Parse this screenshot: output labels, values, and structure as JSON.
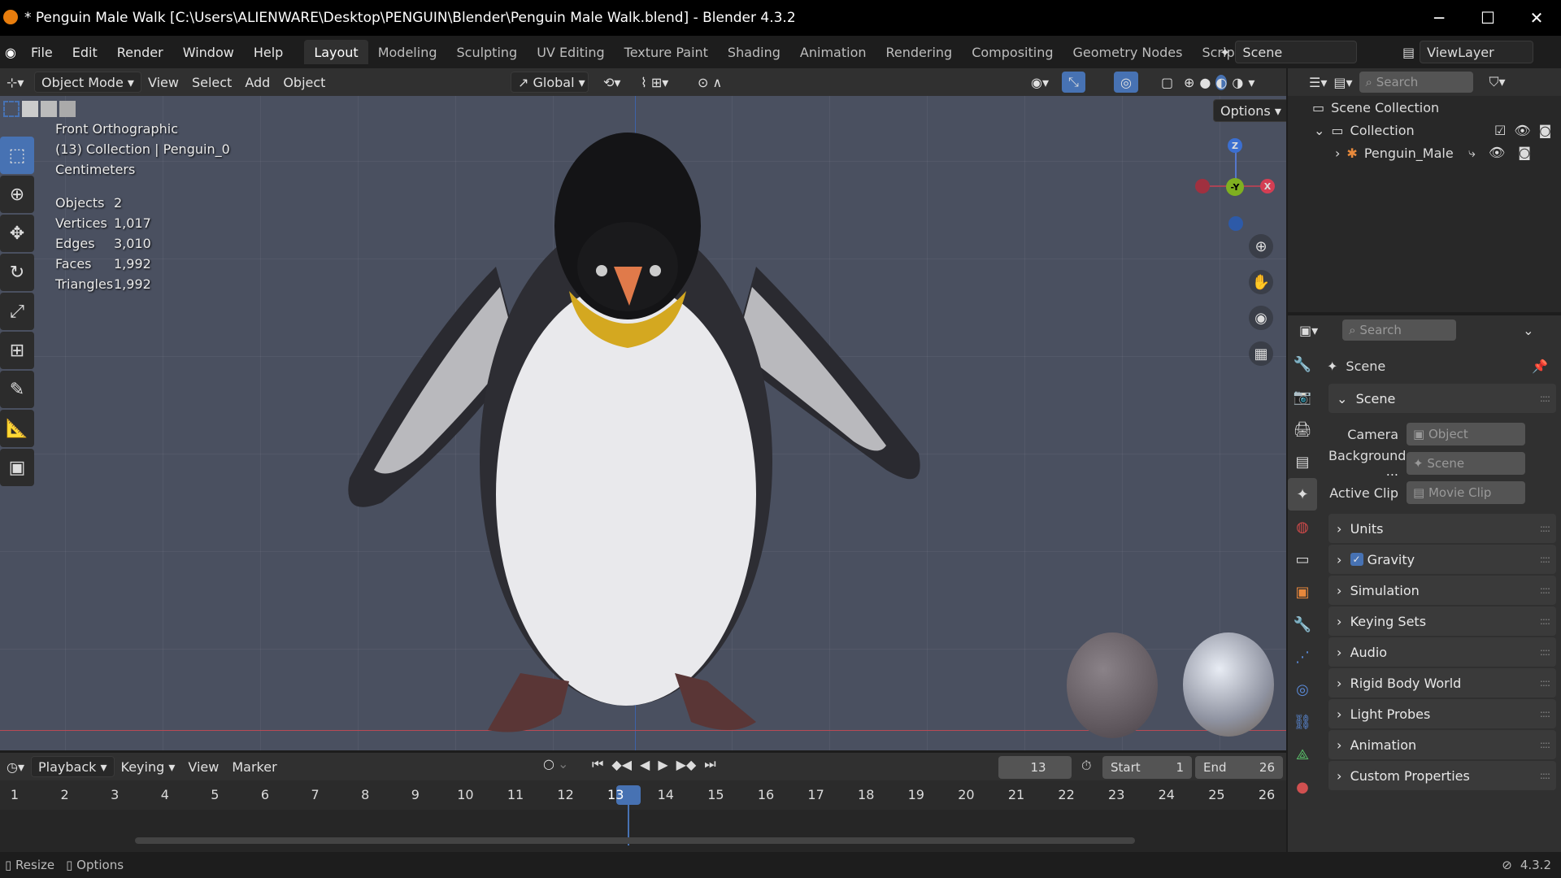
{
  "title": {
    "text": "* Penguin Male Walk [C:\\Users\\ALIENWARE\\Desktop\\PENGUIN\\Blender\\Penguin Male Walk.blend] - Blender 4.3.2",
    "minimize": "─",
    "maximize": "☐",
    "close": "✕"
  },
  "menu": [
    "File",
    "Edit",
    "Render",
    "Window",
    "Help"
  ],
  "workspaces": [
    "Layout",
    "Modeling",
    "Sculpting",
    "UV Editing",
    "Texture Paint",
    "Shading",
    "Animation",
    "Rendering",
    "Compositing",
    "Geometry Nodes",
    "Scripting"
  ],
  "add_workspace": "+",
  "scene_selector": "Scene",
  "viewlayer_selector": "ViewLayer",
  "viewport_header": {
    "mode": "Object Mode",
    "menus": [
      "View",
      "Select",
      "Add",
      "Object"
    ],
    "orientation": "Global",
    "options": "Options"
  },
  "overlay": {
    "view": "Front Orthographic",
    "collection": "(13) Collection | Penguin_0",
    "units": "Centimeters",
    "stats": [
      {
        "label": "Objects",
        "value": "2"
      },
      {
        "label": "Vertices",
        "value": "1,017"
      },
      {
        "label": "Edges",
        "value": "3,010"
      },
      {
        "label": "Faces",
        "value": "1,992"
      },
      {
        "label": "Triangles",
        "value": "1,992"
      }
    ]
  },
  "gizmo": {
    "z": "Z",
    "y": "-Y",
    "x": "X"
  },
  "outliner": {
    "search_placeholder": "Search",
    "scene_collection": "Scene Collection",
    "collection": "Collection",
    "object": "Penguin_Male"
  },
  "properties": {
    "search_placeholder": "Search",
    "context": "Scene",
    "scene_panel": "Scene",
    "camera_label": "Camera",
    "camera_value": "Object",
    "background_label": "Background ...",
    "background_value": "Scene",
    "clip_label": "Active Clip",
    "clip_value": "Movie Clip",
    "panels": [
      "Units",
      "Gravity",
      "Simulation",
      "Keying Sets",
      "Audio",
      "Rigid Body World",
      "Light Probes",
      "Animation",
      "Custom Properties"
    ]
  },
  "timeline": {
    "menus": [
      "Playback",
      "Keying",
      "View",
      "Marker"
    ],
    "current_frame": "13",
    "start_label": "Start",
    "start": "1",
    "end_label": "End",
    "end": "26",
    "frames": [
      "1",
      "2",
      "3",
      "4",
      "5",
      "6",
      "7",
      "8",
      "9",
      "10",
      "11",
      "12",
      "13",
      "14",
      "15",
      "16",
      "17",
      "18",
      "19",
      "20",
      "21",
      "22",
      "23",
      "24",
      "25",
      "26"
    ]
  },
  "status": {
    "resize": "Resize",
    "options": "Options",
    "version": "4.3.2"
  }
}
